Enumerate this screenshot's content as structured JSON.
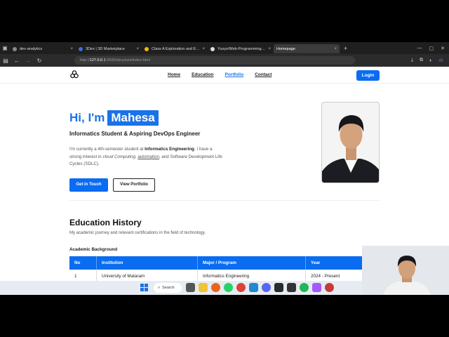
{
  "browser": {
    "tabs": [
      {
        "title": "dev-analytics",
        "color": "#888"
      },
      {
        "title": "3Dex | 3D Marketplace",
        "color": "#3b6fd8"
      },
      {
        "title": "Class A Exploration and Exercise",
        "color": "#f2b90c"
      },
      {
        "title": "Yusyo/Web-Programming: This",
        "color": "#ddd"
      },
      {
        "title": "Homepage",
        "color": "#bbb"
      }
    ],
    "new_tab": "+",
    "url_host": "127.0.0.1",
    "url_prefix": "http://",
    "url_rest": ":5500/structure/index.html"
  },
  "site": {
    "nav": [
      "Home",
      "Education",
      "Portfolio",
      "Contact"
    ],
    "login": "Login",
    "greeting": "Hi, I'm",
    "name": "Mahesa",
    "subtitle": "Informatics Student & Aspiring DevOps Engineer",
    "desc": {
      "p1": "I'm currently a 4th-semester student at ",
      "b1": "Informatics Engineering",
      "p2": ". I have a strong interest in ",
      "i1": "cloud Computing",
      "p3": ", ",
      "u1": "automation",
      "p4": ", and Software Development Life Cycles (SDLC)."
    },
    "btn_touch": "Get in Touch",
    "btn_portfolio": "View Portfolio",
    "edu_title": "Education History",
    "edu_sub": "My academic journey and relevant certifications in the field of technology.",
    "academic_label": "Academic Background",
    "table": {
      "headers": [
        "No",
        "Institution",
        "Major / Program",
        "Year"
      ],
      "rows": [
        [
          "1",
          "University of Mataram",
          "Informatics Engineering",
          "2024 - Present"
        ]
      ]
    }
  },
  "taskbar": {
    "search": "Search"
  },
  "colors": {
    "accent": "#1a73e8",
    "button": "#0a6cf0"
  }
}
